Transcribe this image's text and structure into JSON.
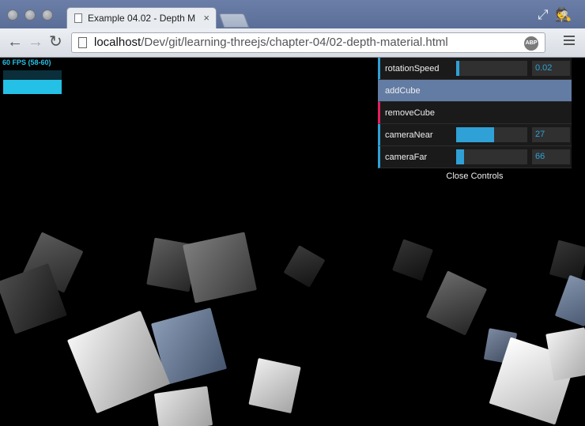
{
  "browser": {
    "tab_title": "Example 04.02 - Depth M",
    "tab_close": "×",
    "url_host": "localhost",
    "url_path": "/Dev/git/learning-threejs/chapter-04/02-depth-material.html",
    "extension_badge": "ABP"
  },
  "stats": {
    "fps_text": "60 FPS (58-60)",
    "color": "#25c0e6"
  },
  "gui": {
    "accent": "#2fa1d6",
    "rows": [
      {
        "label": "rotationSpeed",
        "type": "slider",
        "value": "0.02",
        "fill": 0.04
      },
      {
        "label": "addCube",
        "type": "button"
      },
      {
        "label": "removeCube",
        "type": "button"
      },
      {
        "label": "cameraNear",
        "type": "slider",
        "value": "27",
        "fill": 0.53
      },
      {
        "label": "cameraFar",
        "type": "slider",
        "value": "66",
        "fill": 0.11
      }
    ],
    "close_label": "Close Controls"
  }
}
